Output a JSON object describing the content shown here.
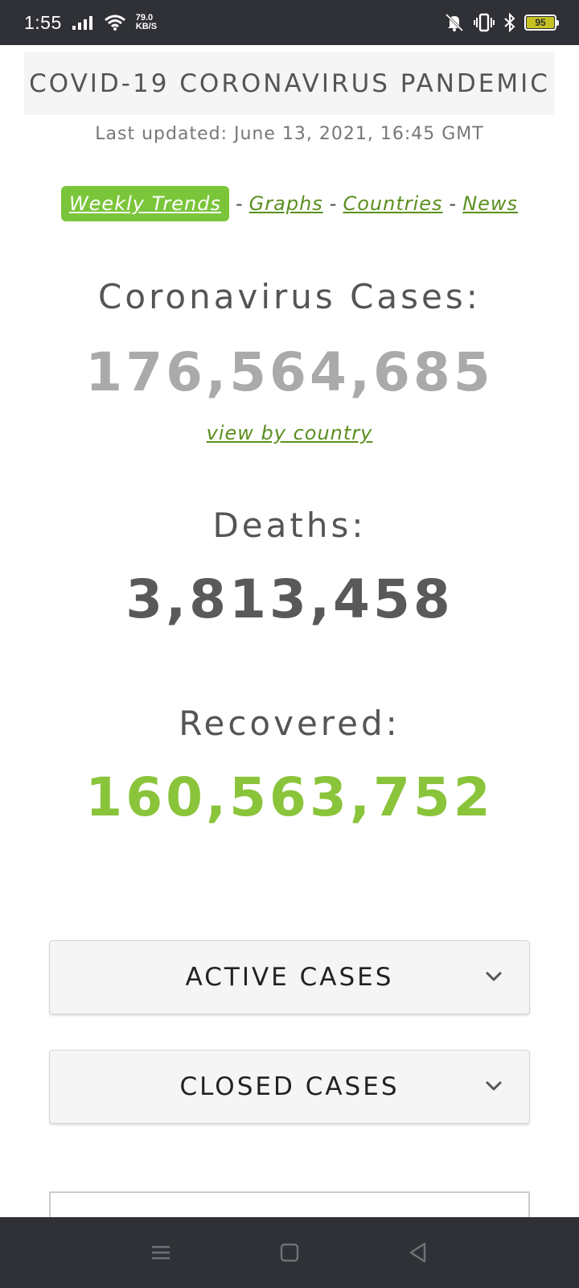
{
  "status_bar": {
    "time": "1:55",
    "speed_value": "79.0",
    "speed_unit": "KB/S",
    "battery": "95",
    "icons": [
      "signal-icon",
      "wifi-icon",
      "mute-icon",
      "vibrate-icon",
      "bluetooth-icon",
      "battery-icon"
    ]
  },
  "header": {
    "title": "COVID-19 CORONAVIRUS PANDEMIC",
    "last_updated": "Last updated: June 13, 2021, 16:45 GMT"
  },
  "nav": {
    "weekly_trends": "Weekly Trends",
    "graphs": "Graphs",
    "countries": "Countries",
    "news": "News",
    "separator": "-"
  },
  "stats": {
    "cases_label": "Coronavirus Cases:",
    "cases_value": "176,564,685",
    "view_by_country": "view by country",
    "deaths_label": "Deaths:",
    "deaths_value": "3,813,458",
    "recovered_label": "Recovered:",
    "recovered_value": "160,563,752"
  },
  "accordions": {
    "active_cases": "ACTIVE CASES",
    "closed_cases": "CLOSED CASES"
  },
  "colors": {
    "accent_green": "#7bc53a",
    "link_green": "#5b8f1f",
    "recovered_green": "#8ac43a",
    "cases_gray": "#aaaaaa",
    "deaths_gray": "#595959",
    "system_bar": "#2f3136"
  }
}
